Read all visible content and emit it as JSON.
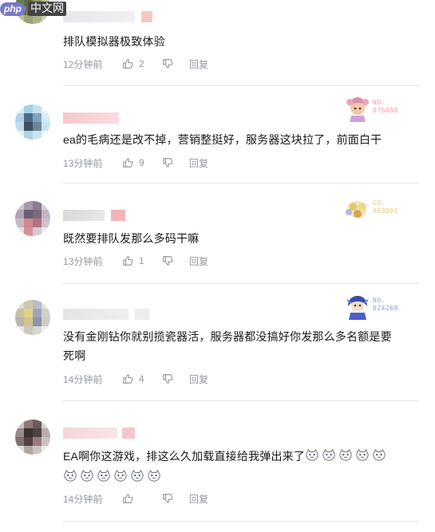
{
  "watermark": {
    "badge": "php",
    "text": "中文网"
  },
  "comments": [
    {
      "text": "排队模拟器极致体验",
      "time": "12分钟前",
      "likes": "2",
      "reply_label": "回复"
    },
    {
      "text": "ea的毛病还是改不掉，营销整挺好，服务器这块拉了，前面白干",
      "time": "13分钟前",
      "likes": "9",
      "reply_label": "回复",
      "fan_badge": {
        "no_label": "NO.",
        "number": "076898",
        "color": "#e7a0ad"
      }
    },
    {
      "text": "既然要排队发那么多码干嘛",
      "time": "13分钟前",
      "likes": "1",
      "reply_label": "回复",
      "fan_badge": {
        "no_label": "CO.",
        "number": "008501",
        "color": "#e3c77a"
      }
    },
    {
      "text_lines": [
        "没有金刚钻你就别揽瓷器活，服务器都没搞好你发那么多名额是要",
        "死啊"
      ],
      "time": "14分钟前",
      "likes": "4",
      "reply_label": "回复",
      "fan_badge": {
        "no_label": "NO.",
        "number": "024268",
        "color": "#8aa0e0"
      }
    },
    {
      "text": "EA啊你这游戏，排这么久加载直接给我弹出来了",
      "emoji_name": "dizzy-face-emoji",
      "emoji_count_line1": 5,
      "emoji_count_line2": 6,
      "time": "14分钟前",
      "likes": "",
      "reply_label": "回复"
    }
  ],
  "colors": {
    "text": "#18191c",
    "meta": "#9499a0",
    "divider": "#e3e5e7"
  }
}
